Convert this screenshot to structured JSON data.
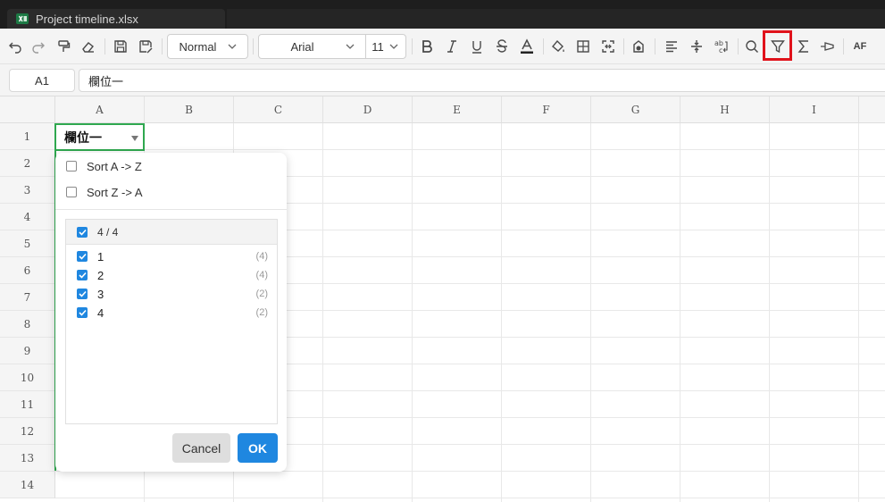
{
  "window": {
    "tab_title": "Project timeline.xlsx"
  },
  "toolbar": {
    "style_value": "Normal",
    "font_value": "Arial",
    "size_value": "11",
    "autofilter_label": "AF",
    "highlighted_tool": "filter-icon",
    "highlight_color": "#e0121b",
    "icons": [
      "undo-icon",
      "redo-icon",
      "format-painter-icon",
      "eraser-icon",
      "save-icon",
      "save-as-icon",
      "bold-icon",
      "italic-icon",
      "underline-icon",
      "strikethrough-icon",
      "font-color-icon",
      "fill-color-icon",
      "borders-icon",
      "merge-cells-icon",
      "conditional-format-icon",
      "align-left-icon",
      "vertical-align-icon",
      "wrap-text-icon",
      "search-icon",
      "filter-icon",
      "sum-icon",
      "freeze-icon"
    ]
  },
  "formula_bar": {
    "cell_ref": "A1",
    "content": "欄位一"
  },
  "grid": {
    "columns": [
      "A",
      "B",
      "C",
      "D",
      "E",
      "F",
      "G",
      "H",
      "I"
    ],
    "rows": [
      "1",
      "2",
      "3",
      "4",
      "5",
      "6",
      "7",
      "8",
      "9",
      "10",
      "11",
      "12",
      "13",
      "14"
    ],
    "a1_value": "欄位一",
    "selection_color": "#2fa84f"
  },
  "filter_panel": {
    "sort_asc": "Sort A -> Z",
    "sort_desc": "Sort Z -> A",
    "select_all": "4 / 4",
    "items": [
      {
        "label": "1",
        "count": "(4)"
      },
      {
        "label": "2",
        "count": "(4)"
      },
      {
        "label": "3",
        "count": "(2)"
      },
      {
        "label": "4",
        "count": "(2)"
      }
    ],
    "cancel_label": "Cancel",
    "ok_label": "OK",
    "accent_color": "#1f87e0"
  }
}
